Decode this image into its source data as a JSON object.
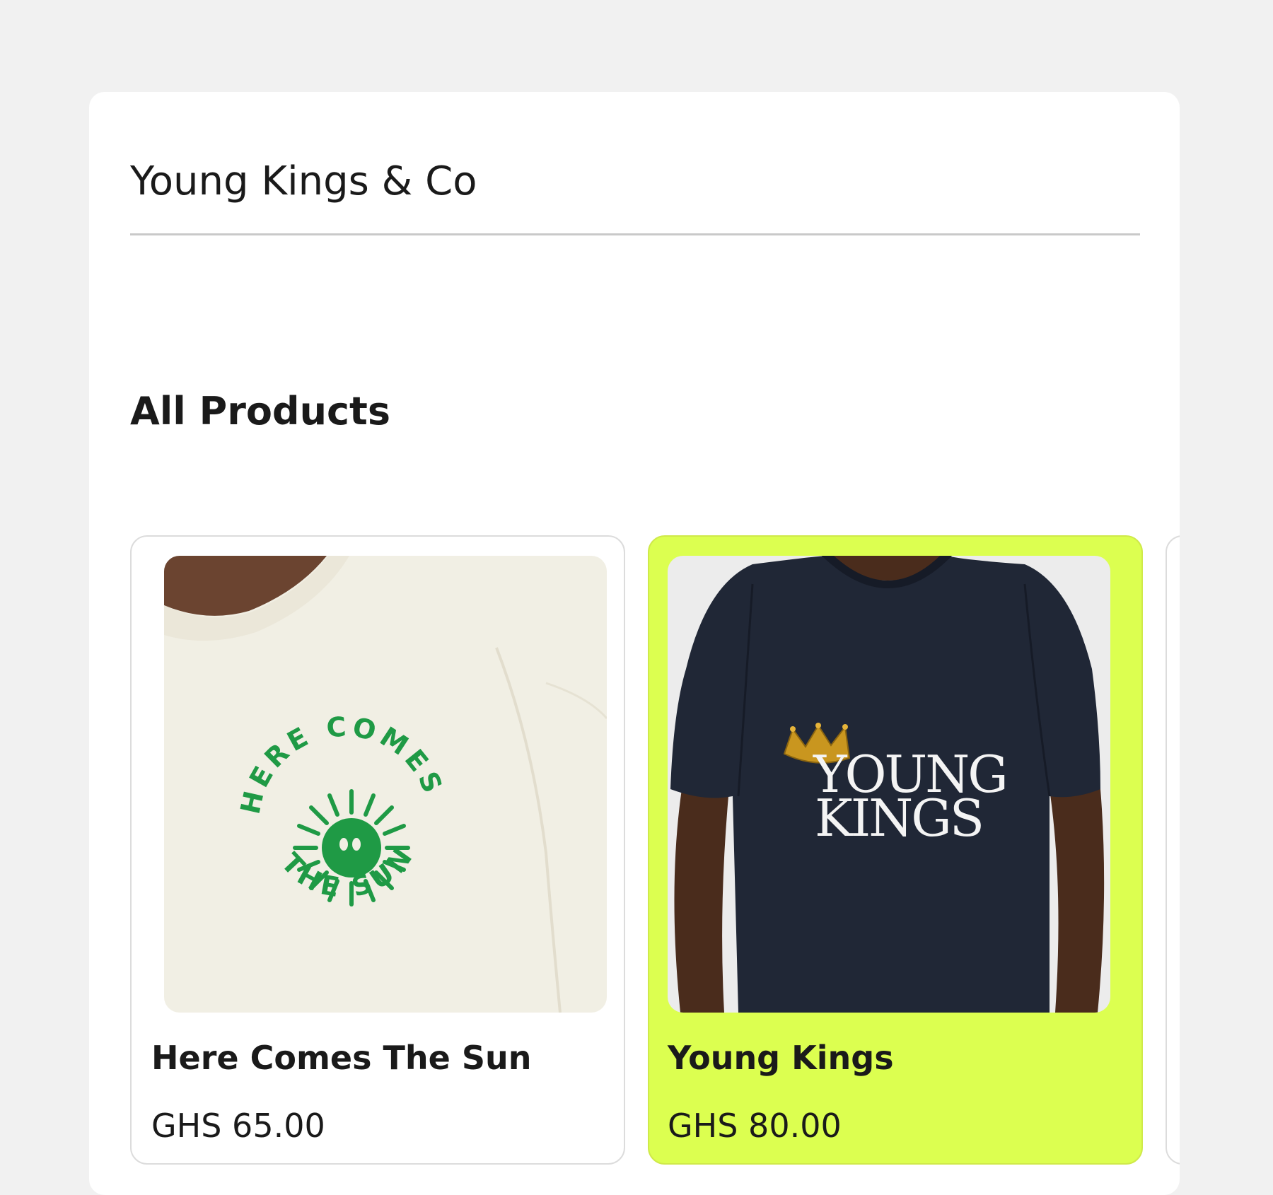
{
  "store": {
    "name": "Young Kings & Co"
  },
  "section": {
    "title": "All Products"
  },
  "products": [
    {
      "title": "Here Comes The Sun",
      "price": "GHS 65.00",
      "print_text": "HERE COMES · THE SUN ·",
      "print_color": "#1f9a45",
      "shirt_color": "#f1efe4"
    },
    {
      "title": "Young Kings",
      "price": "GHS 80.00",
      "print_line1": "YOUNG",
      "print_line2": "KINGS",
      "shirt_color": "#202736",
      "highlight_color": "#dcff50"
    }
  ]
}
